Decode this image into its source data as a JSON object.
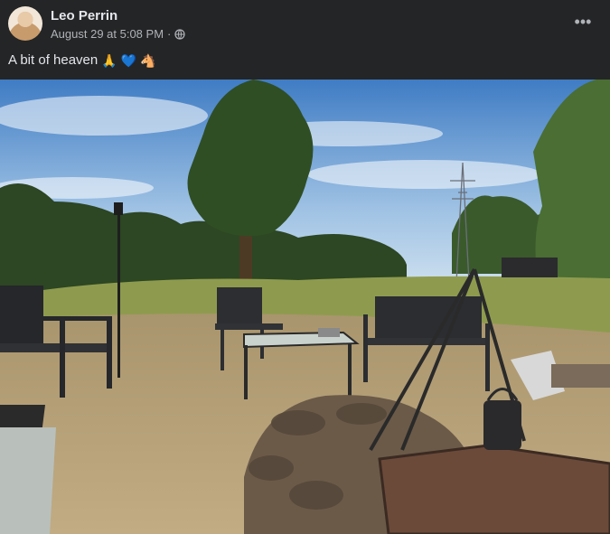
{
  "post": {
    "author": "Leo Perrin",
    "timestamp": "August 29 at 5:08 PM",
    "separator": "·",
    "privacy_icon": "globe-icon",
    "more_icon": "more-horizontal-icon",
    "more_label": "•••",
    "text": "A bit of heaven",
    "emojis": [
      "🙏",
      "💙",
      "🐴"
    ]
  },
  "photo": {
    "subject": "fire pit with chairs and table in a field",
    "colors": {
      "sky_top": "#4d86c9",
      "sky_bottom": "#b9d3ea",
      "grass": "#8e9b4e",
      "dirt": "#b8a07a",
      "trees": "#2f4a24"
    }
  },
  "colors": {
    "background": "#242526",
    "text_primary": "#e4e6eb",
    "text_secondary": "#b0b3b8"
  }
}
